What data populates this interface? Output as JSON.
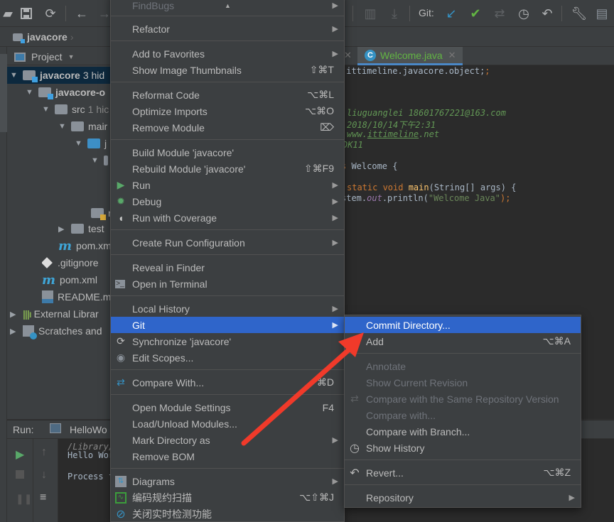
{
  "toolbar": {
    "git_label": "Git:",
    "icons": [
      "open-folder-icon",
      "save-icon",
      "sync-icon",
      "back-icon",
      "forward-icon",
      "build-icon",
      "deploy-icon",
      "git-update-icon",
      "git-commit-icon",
      "git-compare-icon",
      "git-history-icon",
      "git-revert-icon",
      "settings-wrench-icon",
      "project-structure-icon"
    ]
  },
  "breadcrumb": {
    "root": "javacore"
  },
  "project_panel": {
    "selector_label": "Project",
    "tree": [
      {
        "label": "javacore",
        "suffix": "3 hid",
        "level": 0,
        "expanded": true,
        "selected": true,
        "icon": "module-folder-icon"
      },
      {
        "label": "javacore-o",
        "level": 1,
        "expanded": true,
        "icon": "module-folder-icon"
      },
      {
        "label": "src",
        "suffix": "1 hic",
        "level": 2,
        "expanded": true,
        "icon": "folder-icon"
      },
      {
        "label": "mair",
        "level": 3,
        "expanded": true,
        "icon": "folder-icon"
      },
      {
        "label": "j",
        "level": 4,
        "expanded": true,
        "icon": "source-folder-icon"
      },
      {
        "label": "",
        "level": 5,
        "expanded": true,
        "icon": "package-icon"
      },
      {
        "label": "r",
        "level": 4,
        "icon": "resources-folder-icon"
      },
      {
        "label": "test",
        "level": 3,
        "expanded": false,
        "icon": "folder-icon"
      },
      {
        "label": "pom.xm",
        "level": 3,
        "icon": "maven-icon"
      },
      {
        "label": ".gitignore",
        "level": 2,
        "icon": "gitignore-icon"
      },
      {
        "label": "pom.xml",
        "level": 2,
        "icon": "maven-icon"
      },
      {
        "label": "README.m",
        "level": 2,
        "icon": "markdown-icon"
      },
      {
        "label": "External Librar",
        "level": 0,
        "expanded": false,
        "icon": "libraries-icon"
      },
      {
        "label": "Scratches and",
        "level": 0,
        "expanded": false,
        "icon": "scratches-icon"
      }
    ]
  },
  "editor": {
    "tab_label": "Welcome.java",
    "lines": {
      "l1": ".ittimeline.javacore.object;",
      "author": "liuguanglei 18601767221@163.com",
      "date": "2018/10/14下午2:31",
      "site_prefix": "www.",
      "site_link": "ittimeline",
      "site_suffix": ".net",
      "jdk": "DK11",
      "class_kw": "s",
      "class_rest": " Welcome {",
      "main_kw": "static void ",
      "main_fn": "main",
      "main_rest": "(String[] args) {",
      "print_a": "stem.",
      "print_out": "out",
      "print_b": ".println(",
      "print_str": "\"Welcome Java\"",
      "print_c": ");"
    }
  },
  "run_panel": {
    "title": "Run:",
    "config": "HelloWo",
    "output": [
      "/Library/",
      "Hello Wor",
      "",
      "Process f"
    ]
  },
  "context_menu": {
    "items": [
      {
        "label": "FindBugs",
        "submenu": true,
        "partial": true
      },
      {
        "label": "Refactor",
        "submenu": true
      },
      {
        "label": "Add to Favorites",
        "submenu": true
      },
      {
        "label": "Show Image Thumbnails",
        "shortcut": "⇧⌘T"
      },
      {
        "label": "Reformat Code",
        "shortcut": "⌥⌘L"
      },
      {
        "label": "Optimize Imports",
        "shortcut": "⌥⌘O"
      },
      {
        "label": "Remove Module",
        "shortcut": "⌦"
      },
      {
        "label": "Build Module 'javacore'"
      },
      {
        "label": "Rebuild Module 'javacore'",
        "shortcut": "⇧⌘F9"
      },
      {
        "label": "Run",
        "submenu": true,
        "icon": "run-icon"
      },
      {
        "label": "Debug",
        "submenu": true,
        "icon": "debug-icon"
      },
      {
        "label": "Run with Coverage",
        "submenu": true,
        "icon": "coverage-icon"
      },
      {
        "label": "Create Run Configuration",
        "submenu": true
      },
      {
        "label": "Reveal in Finder"
      },
      {
        "label": "Open in Terminal",
        "icon": "terminal-icon"
      },
      {
        "label": "Local History",
        "submenu": true
      },
      {
        "label": "Git",
        "submenu": true,
        "highlighted": true
      },
      {
        "label": "Synchronize 'javacore'",
        "icon": "sync-icon"
      },
      {
        "label": "Edit Scopes...",
        "icon": "scope-icon"
      },
      {
        "label": "Compare With...",
        "shortcut": "⌘D",
        "icon": "compare-icon"
      },
      {
        "label": "Open Module Settings",
        "shortcut": "F4"
      },
      {
        "label": "Load/Unload Modules..."
      },
      {
        "label": "Mark Directory as",
        "submenu": true
      },
      {
        "label": "Remove BOM"
      },
      {
        "label": "Diagrams",
        "submenu": true,
        "icon": "diagrams-icon"
      },
      {
        "label": "编码规约扫描",
        "shortcut": "⌥⇧⌘J",
        "icon": "code-scan-icon"
      },
      {
        "label": "关闭实时检测功能",
        "icon": "disable-detection-icon"
      }
    ]
  },
  "git_submenu": {
    "items": [
      {
        "label": "Commit Directory...",
        "highlighted": true
      },
      {
        "label": "Add",
        "shortcut": "⌥⌘A"
      },
      {
        "label": "Annotate",
        "disabled": true
      },
      {
        "label": "Show Current Revision",
        "disabled": true
      },
      {
        "label": "Compare with the Same Repository Version",
        "disabled": true,
        "icon": "compare-icon"
      },
      {
        "label": "Compare with...",
        "disabled": true
      },
      {
        "label": "Compare with Branch..."
      },
      {
        "label": "Show History",
        "icon": "history-icon"
      },
      {
        "label": "Revert...",
        "shortcut": "⌥⌘Z",
        "icon": "revert-icon"
      },
      {
        "label": "Repository",
        "submenu": true
      }
    ]
  },
  "annotation": {
    "type": "red-arrow",
    "points_to": "Commit Directory...",
    "color": "#f03a2a"
  },
  "colors": {
    "highlight": "#2f65ca",
    "menu_bg": "#3c3f41",
    "editor_bg": "#2b2b2b",
    "tab_text": "#62b543"
  }
}
